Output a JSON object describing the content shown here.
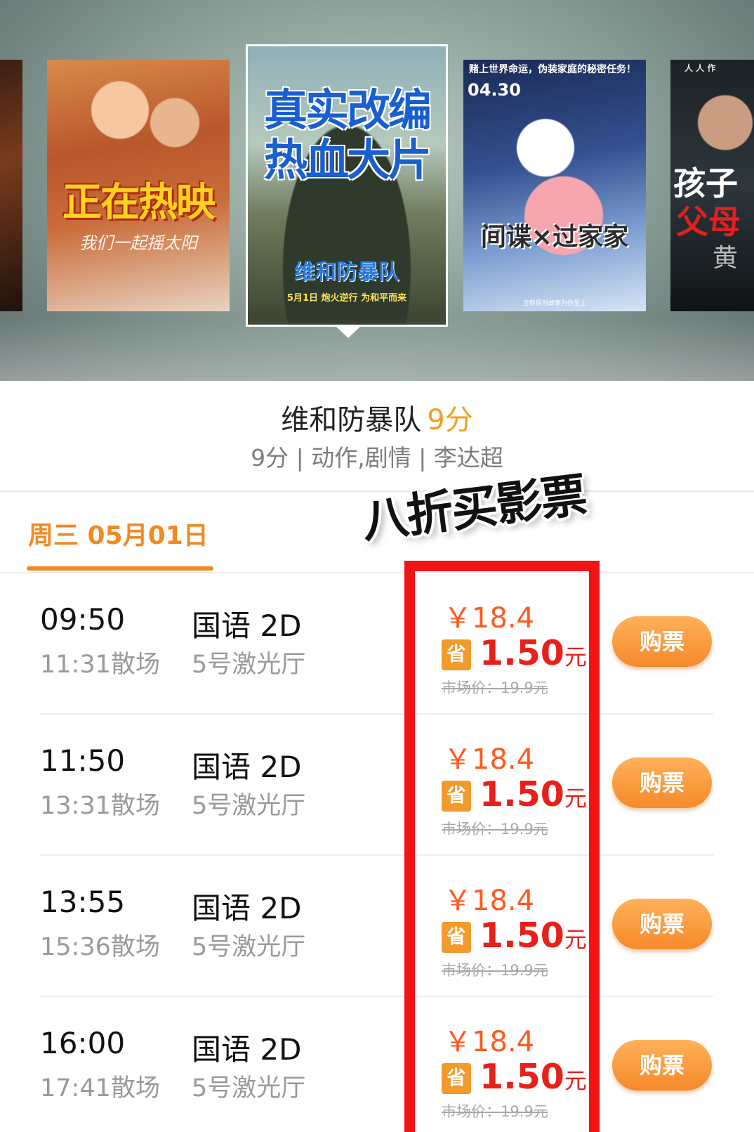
{
  "carousel": {
    "posters": [
      {
        "id": "p0",
        "lines": []
      },
      {
        "id": "p1",
        "headline": "正在热映",
        "subline": "我们一起摇太阳"
      },
      {
        "id": "p2",
        "headline": "真实改编\n热血大片",
        "logo": "维和防暴队",
        "tagline": "5月1日 炮火逆行 为和平而来",
        "selected": true
      },
      {
        "id": "p3",
        "topline": "赌上世界命运，伪装家庭的秘密任务！",
        "date": "04.30",
        "headline": "间谍×过家家",
        "bottom": "全新原创故事为你呈上"
      },
      {
        "id": "p4",
        "topline": "人 人 作",
        "line1": "孩子",
        "line2": "父母",
        "name": "黄"
      }
    ]
  },
  "movie": {
    "title": "维和防暴队",
    "score": "9分",
    "meta": "9分 | 动作,剧情 | 李达超"
  },
  "date_tab": {
    "label": "周三 05月01日"
  },
  "sticker": {
    "text": "八折买影票"
  },
  "showtimes": [
    {
      "start": "09:50",
      "end": "11:31散场",
      "lang": "国语 2D",
      "hall": "5号激光厅",
      "price": "￥18.4",
      "save_badge": "省",
      "save_amount": "1.50",
      "save_unit": "元",
      "market": "市场价：19.9元",
      "buy": "购票"
    },
    {
      "start": "11:50",
      "end": "13:31散场",
      "lang": "国语 2D",
      "hall": "5号激光厅",
      "price": "￥18.4",
      "save_badge": "省",
      "save_amount": "1.50",
      "save_unit": "元",
      "market": "市场价：19.9元",
      "buy": "购票"
    },
    {
      "start": "13:55",
      "end": "15:36散场",
      "lang": "国语 2D",
      "hall": "5号激光厅",
      "price": "￥18.4",
      "save_badge": "省",
      "save_amount": "1.50",
      "save_unit": "元",
      "market": "市场价：19.9元",
      "buy": "购票"
    },
    {
      "start": "16:00",
      "end": "17:41散场",
      "lang": "国语 2D",
      "hall": "5号激光厅",
      "price": "￥18.4",
      "save_badge": "省",
      "save_amount": "1.50",
      "save_unit": "元",
      "market": "市场价：19.9元",
      "buy": "购票"
    }
  ],
  "colors": {
    "accent": "#f08a24",
    "price": "#ff5a1e",
    "save": "#e8201a",
    "highlight_frame": "#f21414"
  }
}
